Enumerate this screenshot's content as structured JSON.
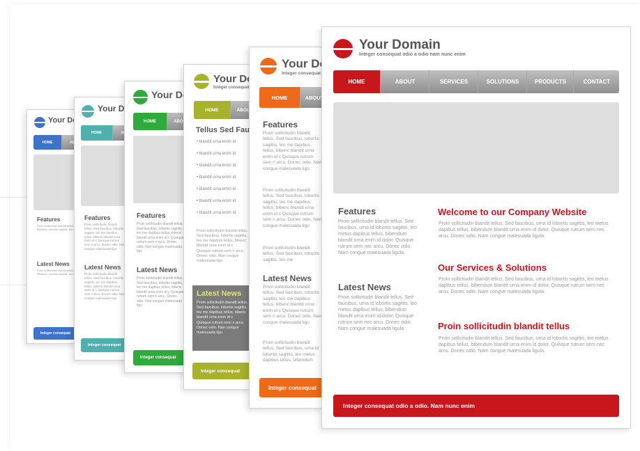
{
  "brand": {
    "title": "Your Domain",
    "tagline": "Integer consequat odio a odio nam nunc enim"
  },
  "nav": [
    "HOME",
    "ABOUT",
    "SERVICES",
    "SOLUTIONS",
    "PRODUCTS",
    "CONTACT"
  ],
  "sidebar": {
    "features_title": "Features",
    "features_text": "Proin sollicitudin blandit tellus. Sed faucibus, urna id lobortis sagittis, leo metus dapibus tellus, bibendum blandit urna enim id dolor. Quisque rutrum sem nec arcu. Donec odio. Nam congue malesuada ligula.",
    "news_title": "Latest News",
    "news_text": "Proin sollicitudin blandit tellus. Sed faucibus, urna id lobortis sagittis, leo metus dapibus tellus, bibendum blandit urna enim id dolor. Quisque rutrum sem nec arcu. Donec odio. Nam congue malesuada ligula."
  },
  "main": {
    "welcome_title": "Welcome to our Company Website",
    "welcome_text": "Proin sollicitudin blandit tellus. Sed faucibus, urna id lobortis sagittis, leo metus dapibus tellus, bibendum blandit urna enim id dolor. Quisque rutrum sem nec arcu. Donec odio. Nam congue malesuada ligula.",
    "services_title": "Our Services & Solutions",
    "services_text": "Proin sollicitudin blandit tellus. Sed faucibus, urna id lobortis sagittis, leo metus dapibus tellus, bibendum blandit urna enim id dolor. Quisque rutrum sem nec arcu. Donec odio. Nam congue malesuada ligula.",
    "proin_title": "Proin sollicitudin blandit tellus",
    "proin_text": "Proin sollicitudin blandit tellus. Sed faucibus, urna id lobortis sagittis, leo metus dapibus tellus, bibendum blandit urna enim id dolor. Quisque rutrum sem nec arcu. Donec odio. Nam congue malesuada ligula."
  },
  "footer_text": "Integer consequat odio a odio. Nam nunc enim",
  "footer_short": "Integer consequat",
  "teal_title": "Tellus Sed Fau",
  "bullet_text": "blandit urna enim id",
  "partial_text": {
    "features": "Proin sollicitudin blandit tellus. Sed faucibus, lobortis sagittis, leo me dapibus tellus, bibenc blandit urna enim id c Quisque rutrum sem n arcu. Donec odio. Nan congue malesuada ligu",
    "short": "Proin sollicitudin blandit tellus. Sed faucibus, lobortis sagittis, leo me"
  },
  "themes": {
    "red": "#c8161d",
    "orange": "#ee6a18",
    "olive": "#a8b22a",
    "green": "#2faa3c",
    "teal": "#4fb0ae",
    "blue": "#3d73c8"
  }
}
